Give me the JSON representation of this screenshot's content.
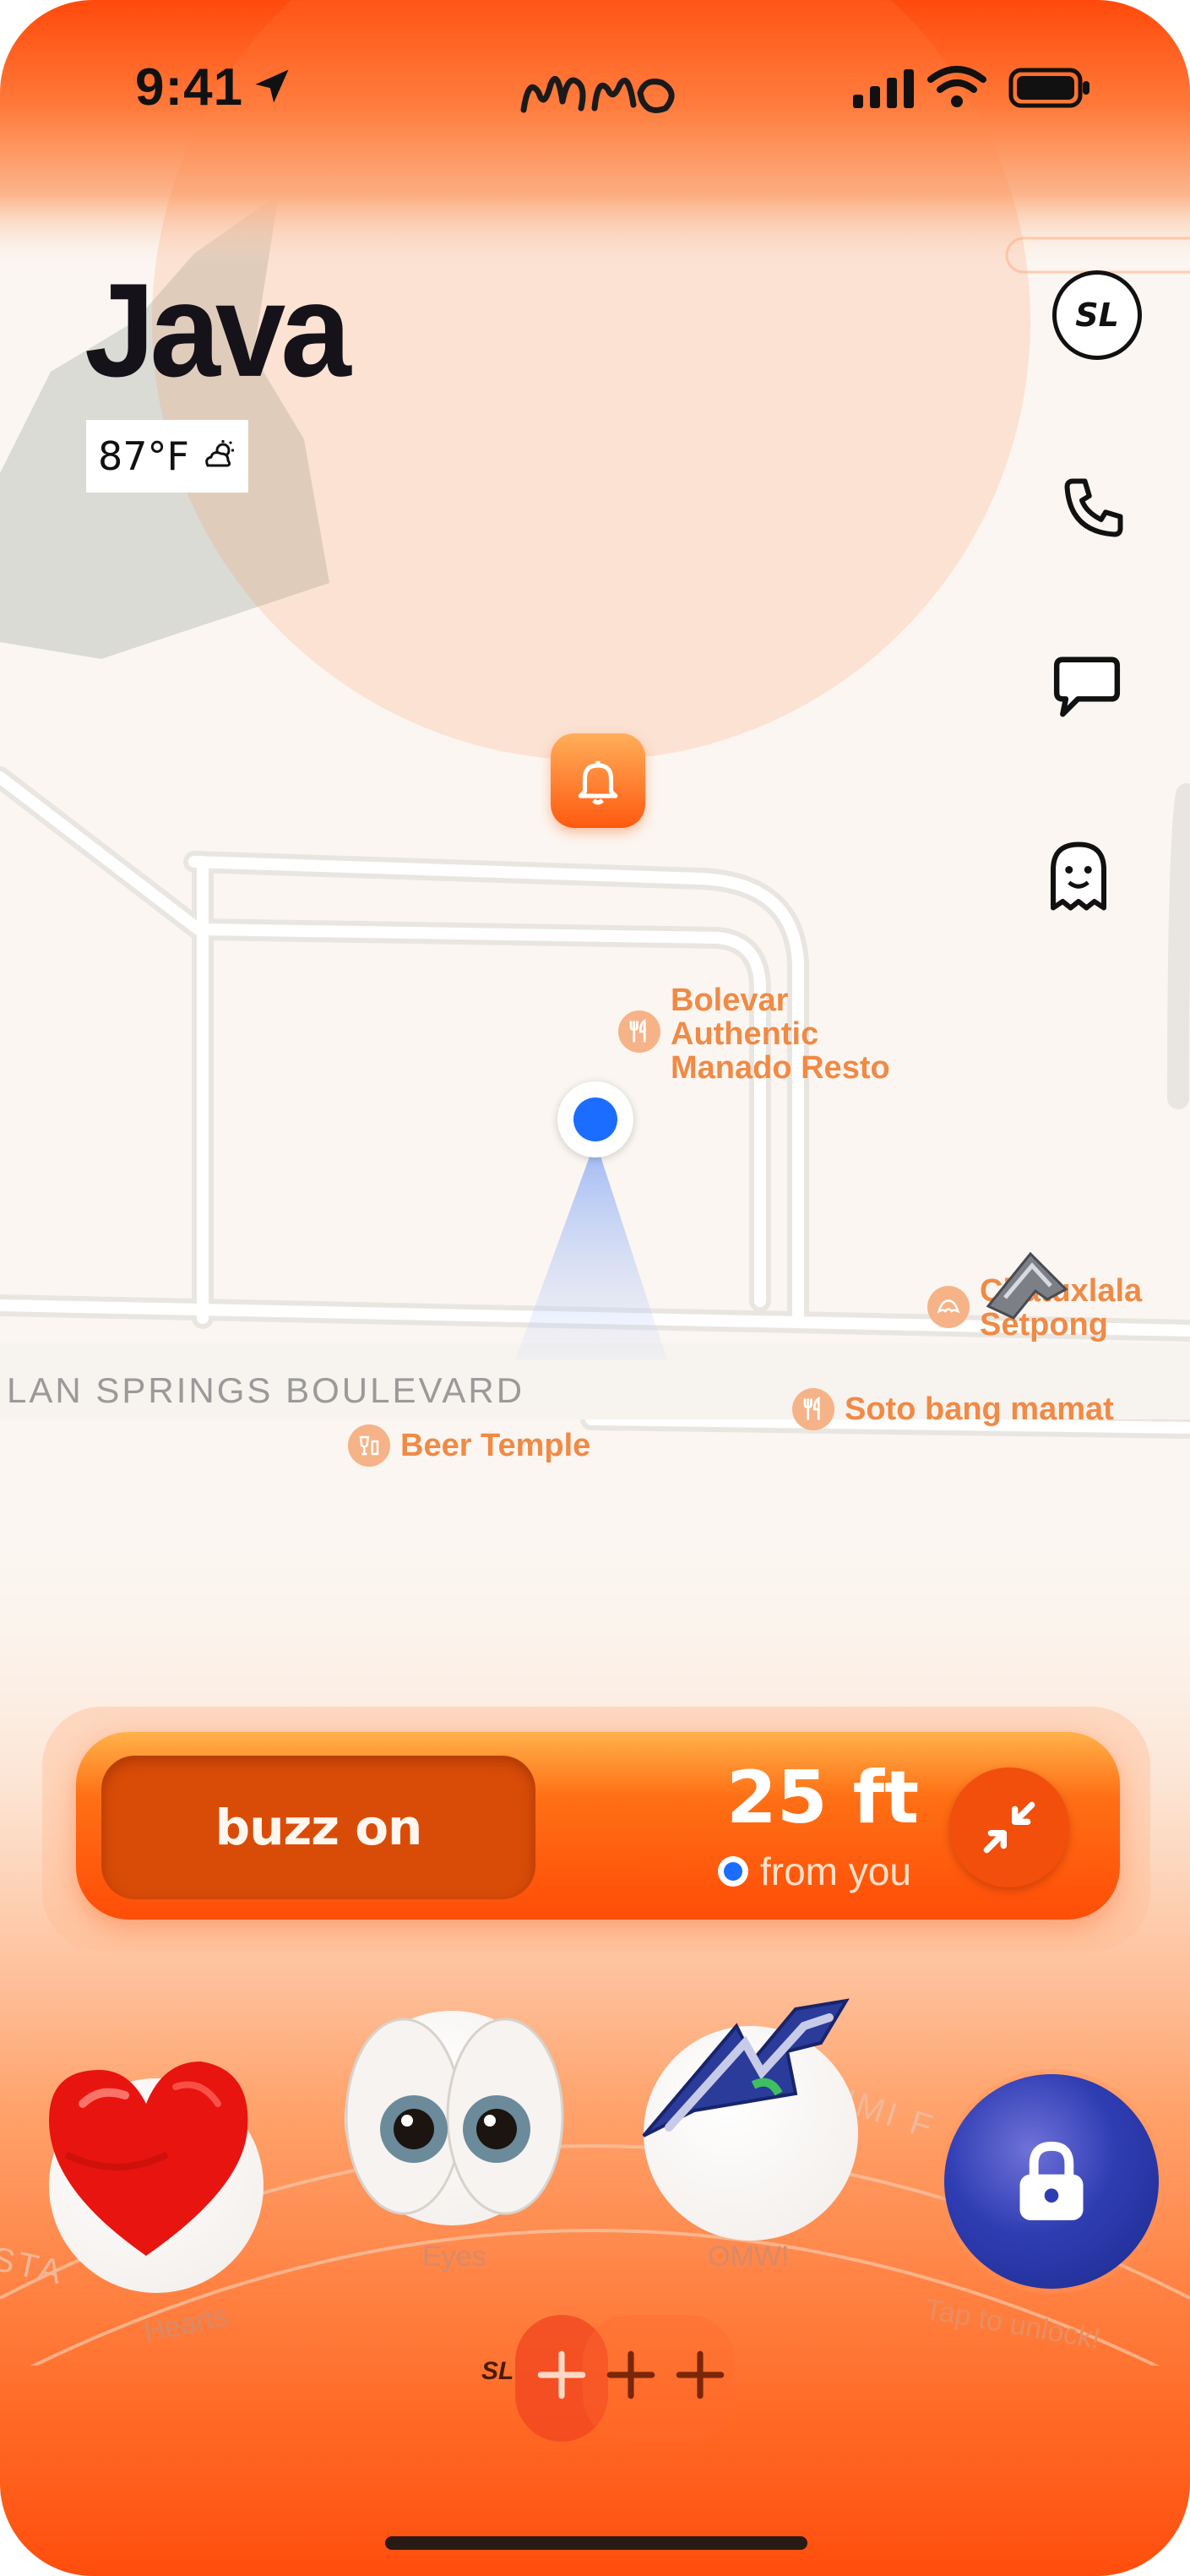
{
  "status_bar": {
    "time": "9:41",
    "logo_text": "amo",
    "icons": [
      "location-arrow-icon",
      "signal-icon",
      "wifi-icon",
      "battery-icon"
    ]
  },
  "location": {
    "title": "Java",
    "weather": {
      "temp": "87°F",
      "icon": "partly-cloudy-icon"
    }
  },
  "side_actions": {
    "profile_initials": "SL",
    "items": [
      "phone-icon",
      "chat-icon",
      "ghost-icon"
    ]
  },
  "map": {
    "alert_icon": "bell-icon",
    "street_name": "LAN SPRINGS BOULEVARD",
    "pois": {
      "bolevar": {
        "label": "Bolevar\nAuthentic\nManado Resto",
        "icon": "restaurant-icon"
      },
      "chatuxlala": {
        "label": "Chatuxlala\nSetpong",
        "icon": "bakery-icon"
      },
      "soto": {
        "label": "Soto bang mamat",
        "icon": "restaurant-icon"
      },
      "beer": {
        "label": "Beer Temple",
        "icon": "drink-icon"
      }
    }
  },
  "buzz": {
    "toggle_label": "buzz on",
    "distance": "25 ft",
    "distance_sub": "from you"
  },
  "reactions": {
    "items": [
      {
        "label": "Hearts",
        "icon": "heart-icon"
      },
      {
        "label": "Eyes",
        "icon": "eyes-icon"
      },
      {
        "label": "OMW!",
        "icon": "arrow-icon"
      }
    ],
    "lock_label": "Tap to unlock!",
    "curved_text_left": "STA",
    "curved_text_right": "UMI F"
  },
  "bottom": {
    "initials": "SL",
    "add_icons": [
      "plus-icon",
      "plus-icon",
      "plus-icon"
    ]
  },
  "colors": {
    "accent": "#ff5a0f",
    "accent_dark": "#d94c08",
    "title": "#15121a",
    "poi": "#f08a45",
    "location_dot": "#1a6dff",
    "lock": "#2f3db3"
  }
}
